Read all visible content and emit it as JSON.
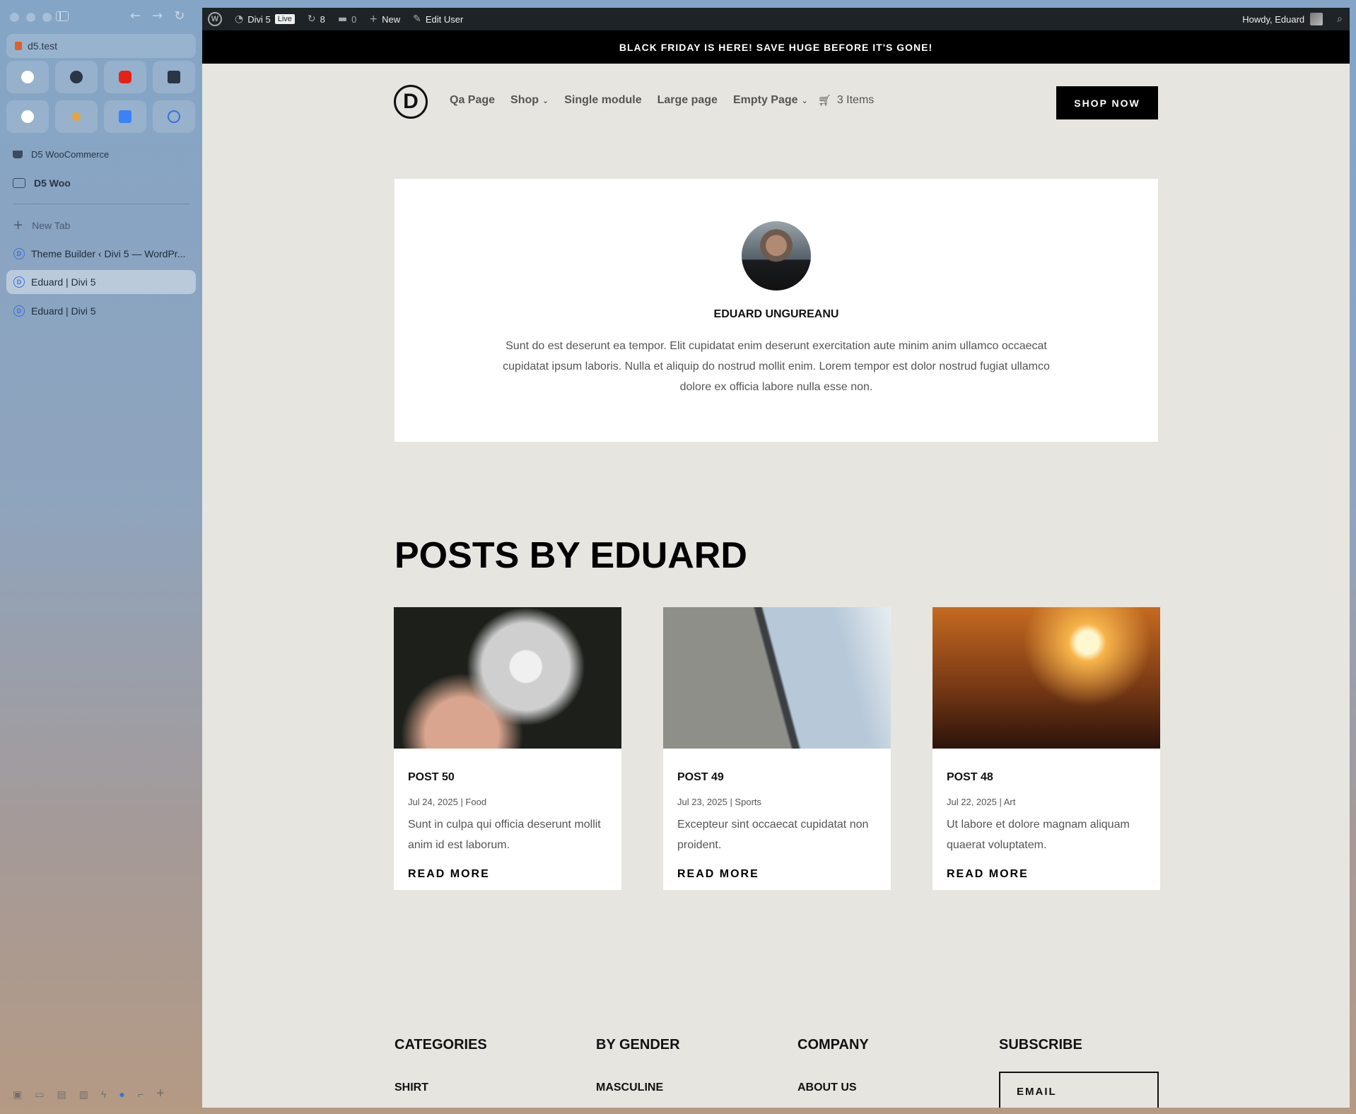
{
  "browser": {
    "url": "d5.test",
    "pinned": [
      {
        "icon": "app-icon-1",
        "color": "#ffffff"
      },
      {
        "icon": "people-icon",
        "color": "#2a3545"
      },
      {
        "icon": "youtube-icon",
        "color": "#e62117"
      },
      {
        "icon": "tools-icon",
        "color": "#2a3545"
      },
      {
        "icon": "openai-icon",
        "color": "#ffffff"
      },
      {
        "icon": "sparkle-icon",
        "color": "#e8a33a"
      },
      {
        "icon": "drive-icon",
        "color": "#3b82f6"
      },
      {
        "icon": "divi-icon",
        "color": "#3b6fd8"
      }
    ],
    "space_label": "D5 WooCommerce",
    "folder_label": "D5 Woo",
    "new_tab_label": "New Tab",
    "tabs": [
      {
        "label": "Theme Builder ‹ Divi 5 — WordPr..."
      },
      {
        "label": "Eduard | Divi 5"
      },
      {
        "label": "Eduard | Divi 5"
      }
    ]
  },
  "adminbar": {
    "site_name": "Divi 5",
    "live_badge": "Live",
    "updates_count": "8",
    "comments_count": "0",
    "new_label": "New",
    "edit_label": "Edit User",
    "greeting": "Howdy, Eduard"
  },
  "promo": "BLACK FRIDAY IS HERE! SAVE HUGE BEFORE IT'S GONE!",
  "header": {
    "logo": "D",
    "menu": [
      "Qa Page",
      "Shop",
      "Single module",
      "Large page",
      "Empty Page"
    ],
    "cart": "3 Items",
    "cta": "SHOP NOW"
  },
  "author": {
    "name": "EDUARD UNGUREANU",
    "bio": "Sunt do est deserunt ea tempor. Elit cupidatat enim deserunt exercitation aute minim anim ullamco occaecat cupidatat ipsum laboris. Nulla et aliquip do nostrud mollit enim. Lorem tempor est dolor nostrud fugiat ullamco dolore ex officia labore nulla esse non."
  },
  "posts_title": "POSTS BY EDUARD",
  "posts": [
    {
      "title": "POST 50",
      "meta": "Jul 24, 2025 | Food",
      "excerpt": "Sunt in culpa qui officia deserunt mollit anim id est laborum.",
      "read_more": "READ MORE"
    },
    {
      "title": "POST 49",
      "meta": "Jul 23, 2025 | Sports",
      "excerpt": "Excepteur sint occaecat cupidatat non proident.",
      "read_more": "READ MORE"
    },
    {
      "title": "POST 48",
      "meta": "Jul 22, 2025 | Art",
      "excerpt": "Ut labore et dolore magnam aliquam quaerat voluptatem.",
      "read_more": "READ MORE"
    }
  ],
  "footer": {
    "categories": {
      "title": "CATEGORIES",
      "first": "SHIRT"
    },
    "gender": {
      "title": "BY GENDER",
      "first": "MASCULINE"
    },
    "company": {
      "title": "COMPANY",
      "first": "ABOUT US"
    },
    "subscribe": {
      "title": "SUBSCRIBE",
      "placeholder": "EMAIL"
    }
  }
}
